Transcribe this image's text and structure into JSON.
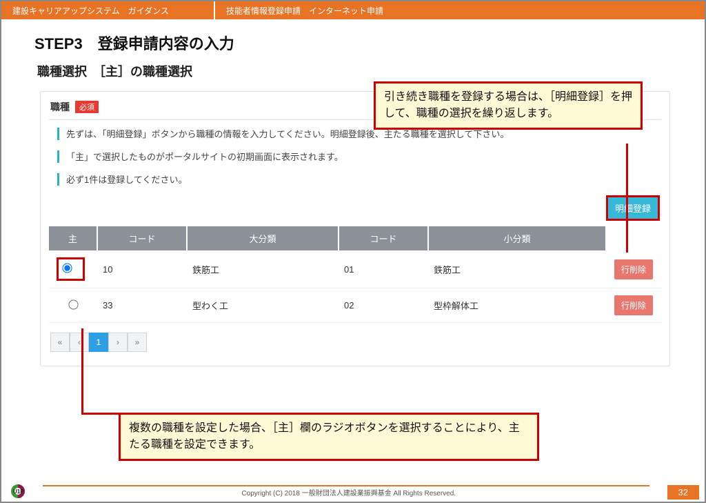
{
  "topbar": {
    "left": "建設キャリアアップシステム　ガイダンス",
    "right": "技能者情報登録申請　インターネット申請"
  },
  "step_heading": "STEP3　登録申請内容の入力",
  "subtitle": "職種選択　［主］の職種選択",
  "panel": {
    "title": "職種",
    "required_label": "必須",
    "guides": [
      "先ずは、「明細登録」ボタンから職種の情報を入力してください。明細登録後、主たる職種を選択して下さい。",
      "「主」で選択したものがポータルサイトの初期画面に表示されます。",
      "必ず1件は登録してください。"
    ]
  },
  "callouts": {
    "top": "引き続き職種を登録する場合は、［明細登録］を押して、職種の選択を繰り返します。",
    "bottom": "複数の職種を設定した場合、［主］欄のラジオボタンを選択することにより、主たる職種を設定できます。"
  },
  "buttons": {
    "add_detail": "明細登録",
    "row_delete": "行削除"
  },
  "table": {
    "headers": {
      "main": "主",
      "code1": "コード",
      "major": "大分類",
      "code2": "コード",
      "minor": "小分類",
      "action": ""
    },
    "rows": [
      {
        "selected": true,
        "code1": "10",
        "major": "鉄筋工",
        "code2": "01",
        "minor": "鉄筋工"
      },
      {
        "selected": false,
        "code1": "33",
        "major": "型わく工",
        "code2": "02",
        "minor": "型枠解体工"
      }
    ]
  },
  "pager": {
    "first": "«",
    "prev": "‹",
    "page": "1",
    "next": "›",
    "last": "»"
  },
  "footer": {
    "copyright": "Copyright (C) 2018 一般財団法人建設業振興基金 All Rights Reserved.",
    "page_number": "32"
  }
}
